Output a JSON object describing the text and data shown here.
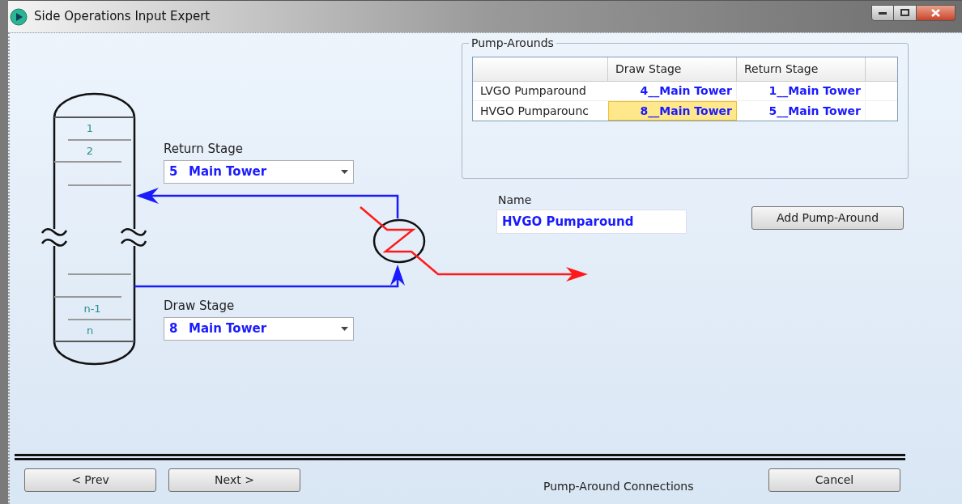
{
  "window": {
    "title": "Side Operations Input Expert"
  },
  "column_stages": [
    {
      "label": "1"
    },
    {
      "label": "2"
    },
    {
      "label": "n-1"
    },
    {
      "label": "n"
    }
  ],
  "return_stage": {
    "label": "Return Stage",
    "number": "5",
    "tower": "Main Tower"
  },
  "draw_stage": {
    "label": "Draw Stage",
    "number": "8",
    "tower": "Main Tower"
  },
  "pump_arounds": {
    "title": "Pump-Arounds",
    "columns": [
      "Draw Stage",
      "Return Stage"
    ],
    "rows": [
      {
        "name": "LVGO Pumparound",
        "draw": {
          "text": "4__Main Tower",
          "selected": false
        },
        "return": {
          "text": "1__Main Tower",
          "selected": false
        }
      },
      {
        "name": "HVGO Pumparounc",
        "draw": {
          "text": "8__Main Tower",
          "selected": true
        },
        "return": {
          "text": "5__Main Tower",
          "selected": false
        }
      }
    ]
  },
  "name_field": {
    "label": "Name",
    "value": "HVGO Pumparound"
  },
  "add_button": "Add Pump-Around",
  "footer": {
    "prev": "< Prev",
    "next": "Next >",
    "status": "Pump-Around Connections",
    "cancel": "Cancel"
  }
}
